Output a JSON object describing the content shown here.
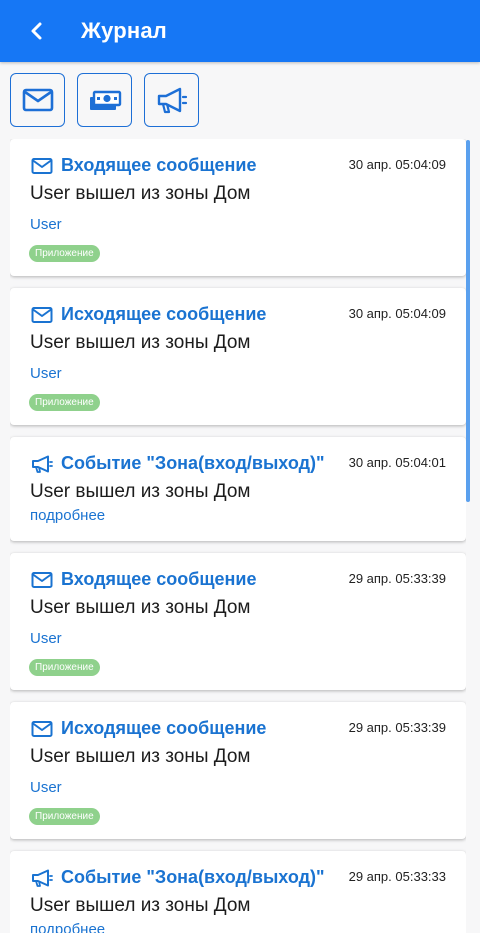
{
  "header": {
    "title": "Журнал",
    "back_icon": "chevron-left-icon"
  },
  "filters": [
    {
      "icon": "mail-icon"
    },
    {
      "icon": "money-icon"
    },
    {
      "icon": "megaphone-icon"
    }
  ],
  "colors": {
    "accent": "#1677f5",
    "link": "#1a73d1",
    "badge": "#8fd18c"
  },
  "journal": {
    "entries": [
      {
        "icon": "mail-icon",
        "type": "Входящее сообщение",
        "time": "30 апр. 05:04:09",
        "text": "User вышел из зоны Дом",
        "link": "User",
        "badge": "Приложение"
      },
      {
        "icon": "mail-icon",
        "type": "Исходящее сообщение",
        "time": "30 апр. 05:04:09",
        "text": "User вышел из зоны Дом",
        "link": "User",
        "badge": "Приложение"
      },
      {
        "icon": "megaphone-icon",
        "type": "Событие \"Зона(вход/выход)\"",
        "time": "30 апр. 05:04:01",
        "text": "User вышел из зоны Дом",
        "link": "подробнее"
      },
      {
        "icon": "mail-icon",
        "type": "Входящее сообщение",
        "time": "29 апр. 05:33:39",
        "text": "User вышел из зоны Дом",
        "link": "User",
        "badge": "Приложение"
      },
      {
        "icon": "mail-icon",
        "type": "Исходящее сообщение",
        "time": "29 апр. 05:33:39",
        "text": "User вышел из зоны Дом",
        "link": "User",
        "badge": "Приложение"
      },
      {
        "icon": "megaphone-icon",
        "type": "Событие \"Зона(вход/выход)\"",
        "time": "29 апр. 05:33:33",
        "text": "User вышел из зоны Дом",
        "link": "подробнее"
      }
    ]
  }
}
